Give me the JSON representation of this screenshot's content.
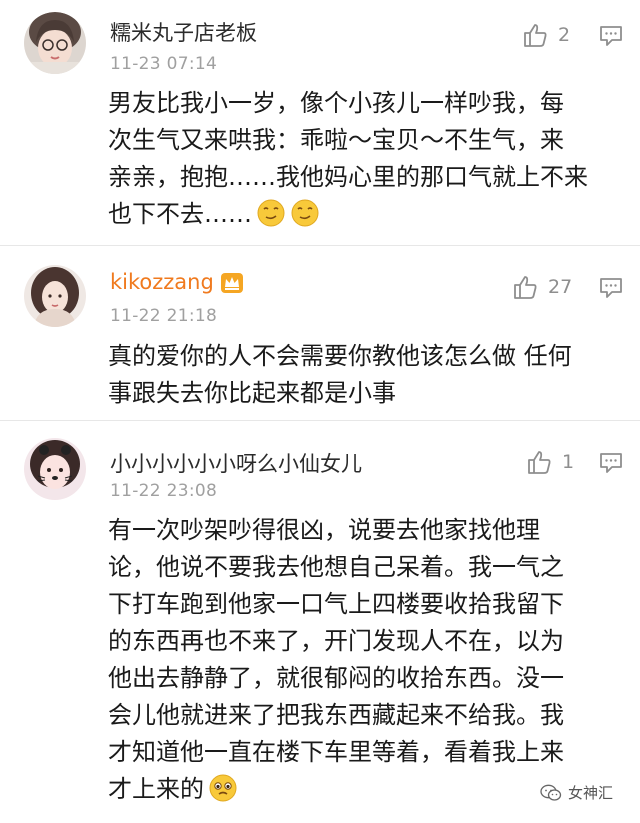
{
  "comments": [
    {
      "username": "糯米丸子店老板",
      "time": "11-23 07:14",
      "likes": "2",
      "lines": [
        "男友比我小一岁，像个小孩儿一样吵我，每",
        "次生气又来哄我：乖啦～宝贝～不生气，来",
        "亲亲，抱抱……我他妈心里的那口气就上不来",
        "也下不去……"
      ],
      "emojis": [
        "smirk-emoji",
        "smirk-emoji"
      ]
    },
    {
      "username": "kikozzang",
      "username_color": "#f07a1e",
      "badge": "crown-icon",
      "time": "11-22 21:18",
      "likes": "27",
      "lines": [
        "真的爱你的人不会需要你教他该怎么做 任何",
        "事跟失去你比起来都是小事"
      ]
    },
    {
      "username": "小小小小小小呀么小仙女儿",
      "time": "11-22 23:08",
      "likes": "1",
      "lines": [
        "有一次吵架吵得很凶，说要去他家找他理",
        "论，他说不要我去他想自己呆着。我一气之",
        "下打车跑到他家一口气上四楼要收拾我留下",
        "的东西再也不来了，开门发现人不在，以为",
        "他出去静静了，就很郁闷的收拾东西。没一",
        "会儿他就进来了把我东西藏起来不给我。我",
        "才知道他一直在楼下车里等着，看着我上来",
        "才上来的"
      ],
      "emojis": [
        "pleading-emoji"
      ]
    }
  ],
  "watermark": "女神汇",
  "icons": {
    "like": "thumbs-up-icon",
    "reply": "comment-icon"
  },
  "colors": {
    "accent": "#f07a1e",
    "muted": "#a0a0a0",
    "divider": "#e7e7e7"
  }
}
